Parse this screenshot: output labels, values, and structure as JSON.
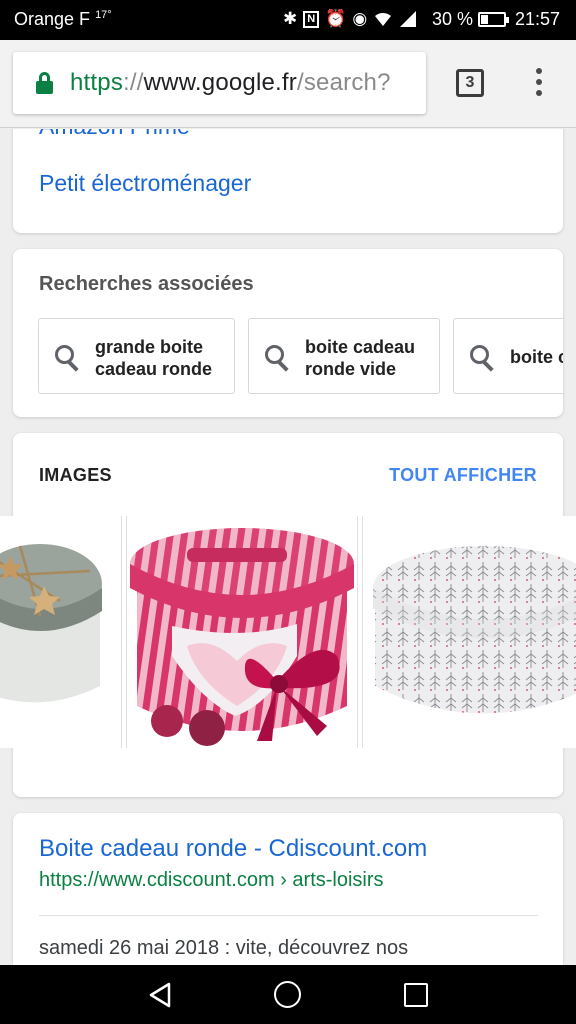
{
  "status_bar": {
    "carrier": "Orange F",
    "temperature": "17°",
    "battery_percent": "30 %",
    "battery_level": 0.3,
    "time": "21:57",
    "icons": [
      "bluetooth-icon",
      "nfc-icon",
      "alarm-icon",
      "eye-icon",
      "wifi-icon",
      "signal-icon",
      "battery-icon"
    ]
  },
  "browser": {
    "url_scheme": "https",
    "url_separator": "://",
    "url_host": "www.google.fr",
    "url_path": "/search?",
    "tab_count": "3"
  },
  "previous_results": {
    "partial_link": "Amazon Prime",
    "link": "Petit électroménager"
  },
  "related_searches": {
    "title": "Recherches associées",
    "chips": [
      {
        "line1": "grande boite",
        "line2": "cadeau ronde"
      },
      {
        "line1": "boite cadeau",
        "line2": "ronde vide"
      },
      {
        "line1": "boite c",
        "line2": ""
      }
    ]
  },
  "images": {
    "title": "IMAGES",
    "see_all": "TOUT AFFICHER"
  },
  "result": {
    "title": "Boite cadeau ronde - Cdiscount.com",
    "url": "https://www.cdiscount.com › arts-loisirs",
    "snippet": "samedi 26 mai 2018 : vite, découvrez nos"
  },
  "colors": {
    "link": "#1967d2",
    "url_green": "#0b8043",
    "accent_blue": "#4285f4"
  }
}
